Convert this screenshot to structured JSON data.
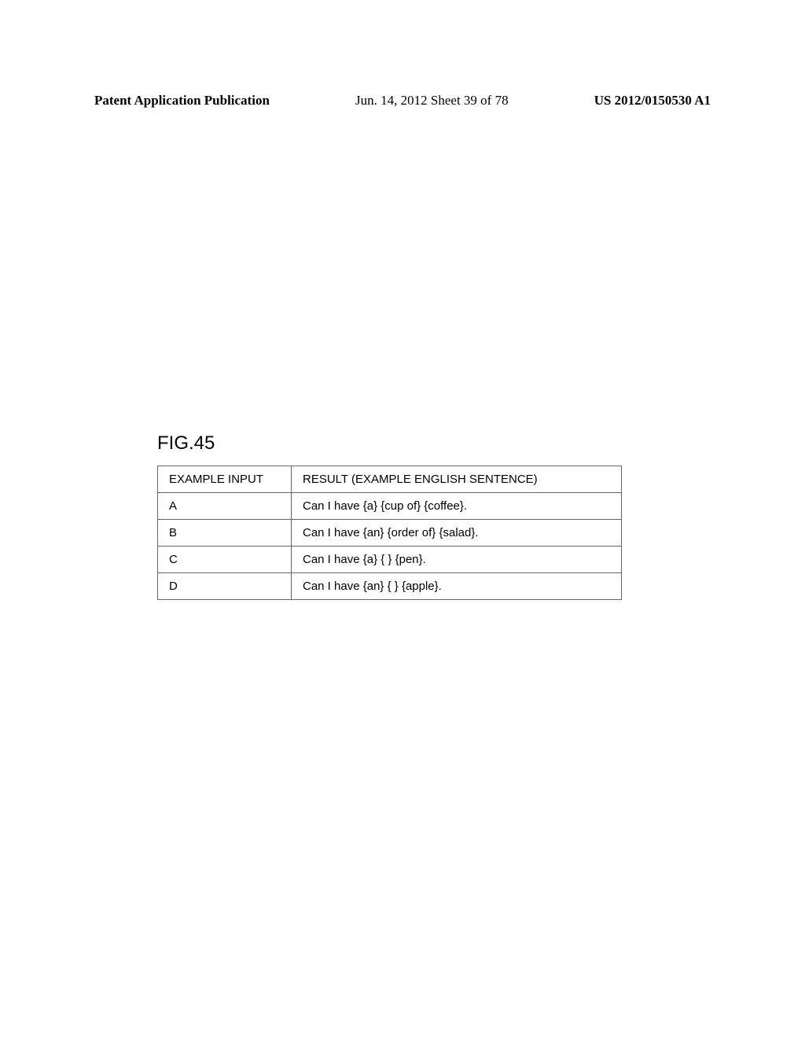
{
  "header": {
    "left": "Patent Application Publication",
    "center": "Jun. 14, 2012  Sheet 39 of 78",
    "right": "US 2012/0150530 A1"
  },
  "figure_label": "FIG.45",
  "table": {
    "headers": {
      "col1": "EXAMPLE INPUT",
      "col2": "RESULT (EXAMPLE ENGLISH SENTENCE)"
    },
    "rows": [
      {
        "input": "A",
        "result": "Can I have {a} {cup of} {coffee}."
      },
      {
        "input": "B",
        "result": "Can I have {an} {order of} {salad}."
      },
      {
        "input": "C",
        "result": "Can I have {a} { } {pen}."
      },
      {
        "input": "D",
        "result": "Can I have {an} { } {apple}."
      }
    ]
  }
}
